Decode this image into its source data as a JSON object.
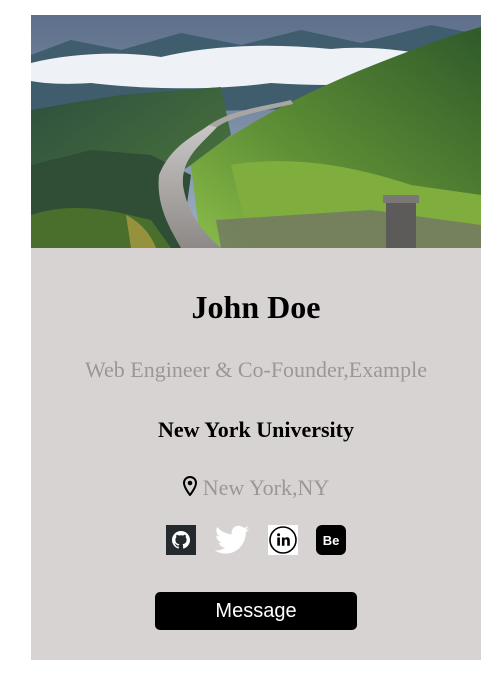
{
  "profile": {
    "name": "John Doe",
    "title": "Web Engineer & Co-Founder,Example",
    "school": "New York University",
    "location": "New York,NY"
  },
  "socials": [
    {
      "icon": "github-icon"
    },
    {
      "icon": "twitter-icon"
    },
    {
      "icon": "linkedin-icon"
    },
    {
      "icon": "behance-icon"
    }
  ],
  "actions": {
    "message_label": "Message"
  },
  "colors": {
    "card_background": "#d8d3d3",
    "muted_text": "#9c9696",
    "button_background": "#000000",
    "button_text": "#ffffff"
  }
}
